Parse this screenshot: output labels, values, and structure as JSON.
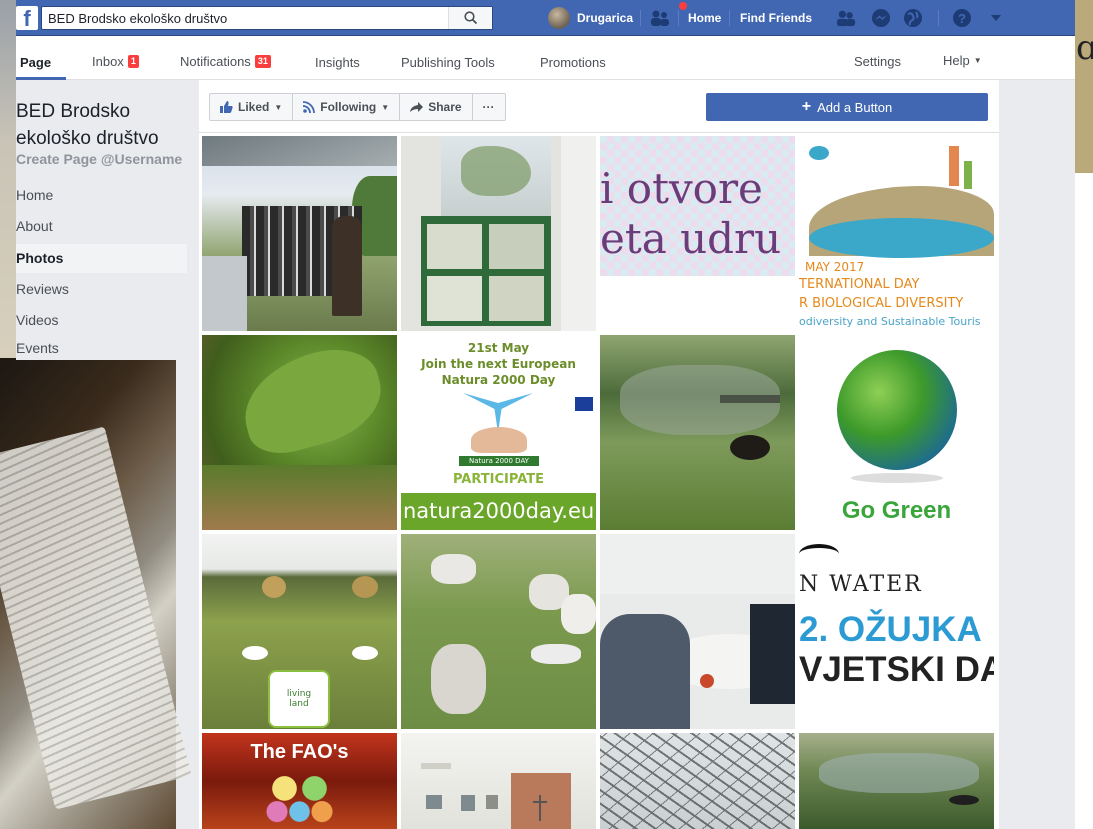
{
  "topbar": {
    "search_value": "BED Brodsko ekološko društvo",
    "profile_name": "Drugarica",
    "home": "Home",
    "find_friends": "Find Friends"
  },
  "pagenav": {
    "page": "Page",
    "inbox": "Inbox",
    "inbox_count": "1",
    "notifications": "Notifications",
    "notifications_count": "31",
    "insights": "Insights",
    "publishing_tools": "Publishing Tools",
    "promotions": "Promotions",
    "settings": "Settings",
    "help": "Help"
  },
  "sidebar": {
    "page_name": "BED Brodsko ekološko društvo",
    "username_link": "Create Page @Username",
    "items": [
      {
        "label": "Home"
      },
      {
        "label": "About"
      },
      {
        "label": "Photos",
        "active": true
      },
      {
        "label": "Reviews"
      },
      {
        "label": "Videos"
      },
      {
        "label": "Events"
      }
    ]
  },
  "actions": {
    "liked": "Liked",
    "following": "Following",
    "share": "Share",
    "more": "···",
    "add_button": "Add a Button"
  },
  "photos": {
    "p3": {
      "line1": "i otvore",
      "line2": "eta udru"
    },
    "p4": {
      "line1": "MAY 2017",
      "line2": "TERNATIONAL DAY",
      "line3": "R BIOLOGICAL DIVERSITY",
      "line4": "odiversity and Sustainable Touris"
    },
    "p6": {
      "line1": "21st May",
      "line2": "Join the next European",
      "line3": "Natura 2000 Day",
      "badge": "Natura 2000 DAY",
      "participate": "PARTICIPATE",
      "url": "natura2000day.eu"
    },
    "p8": {
      "caption": "Go Green"
    },
    "p9": {
      "logo": "living land"
    },
    "p12": {
      "line1": "N WATER",
      "line2": "2. OŽUJKA",
      "line3": "VJETSKI DA"
    },
    "p13": {
      "title": "The FAO's"
    }
  },
  "colors": {
    "fb_blue": "#4267b2",
    "badge_red": "#fa3e3e",
    "go_green": "#3aa53a",
    "water_blue": "#2d9bd3"
  }
}
